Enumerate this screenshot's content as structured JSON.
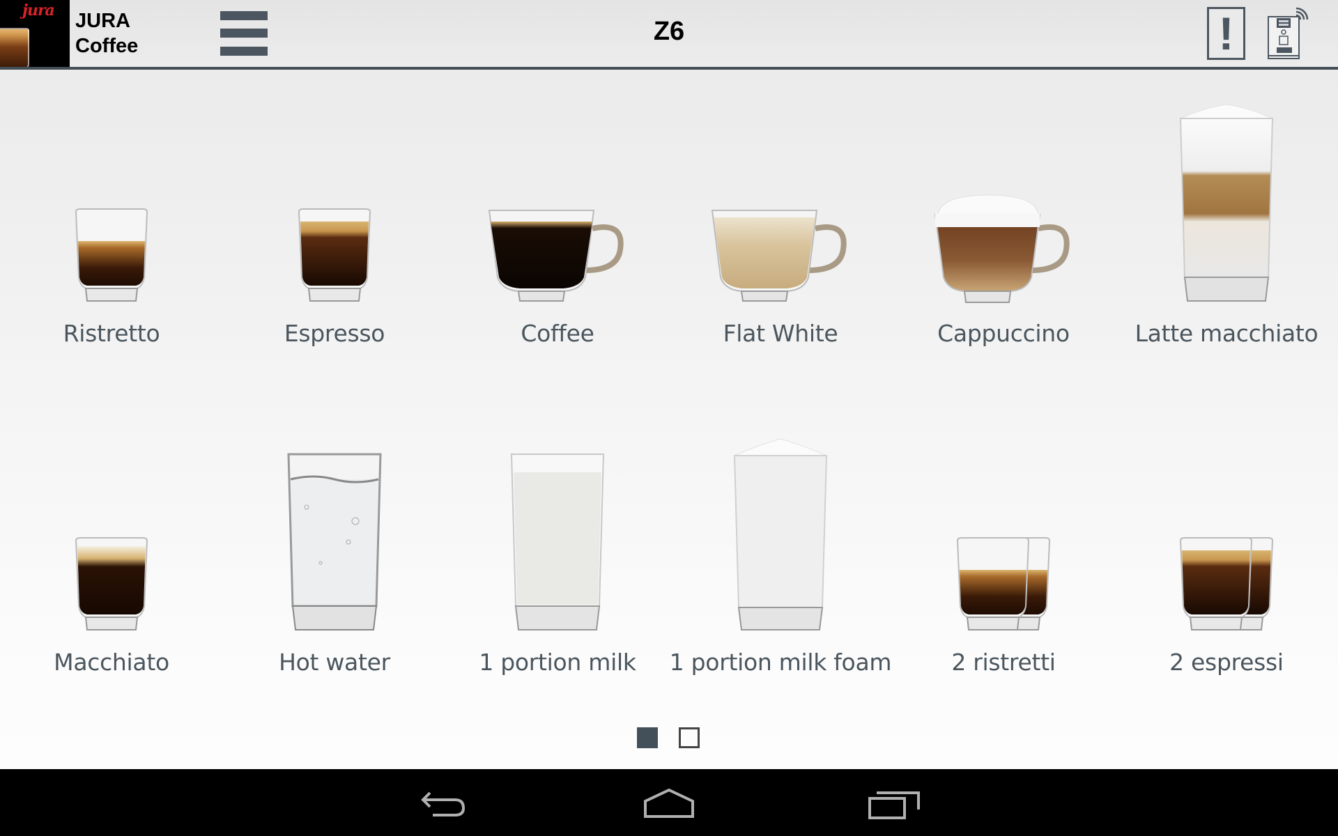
{
  "header": {
    "logo_brand": "jura",
    "app_title_line1": "JURA",
    "app_title_line2": "Coffee",
    "page_title": "Z6",
    "alert_symbol": "!",
    "icons": [
      "hamburger-menu-icon",
      "alert-icon",
      "coffee-machine-wifi-icon"
    ]
  },
  "products": [
    {
      "label": "Ristretto",
      "icon": "ristretto-glass"
    },
    {
      "label": "Espresso",
      "icon": "espresso-glass"
    },
    {
      "label": "Coffee",
      "icon": "coffee-cup"
    },
    {
      "label": "Flat White",
      "icon": "flat-white-cup"
    },
    {
      "label": "Cappuccino",
      "icon": "cappuccino-cup"
    },
    {
      "label": "Latte macchiato",
      "icon": "latte-macchiato-glass"
    },
    {
      "label": "Macchiato",
      "icon": "macchiato-glass"
    },
    {
      "label": "Hot water",
      "icon": "hot-water-glass"
    },
    {
      "label": "1 portion milk",
      "icon": "milk-glass"
    },
    {
      "label": "1 portion milk foam",
      "icon": "milk-foam-glass"
    },
    {
      "label": "2 ristretti",
      "icon": "two-ristretti-glasses"
    },
    {
      "label": "2 espressi",
      "icon": "two-espressi-glasses"
    }
  ],
  "pager": {
    "current_page": 1,
    "total_pages": 2
  },
  "colors": {
    "accent": "#435059",
    "header_bg": "#e8e8e8",
    "label_text": "#4a555d",
    "brand_red": "#d9222a"
  },
  "navbar": {
    "icons": [
      "back-icon",
      "home-icon",
      "recent-apps-icon"
    ]
  }
}
